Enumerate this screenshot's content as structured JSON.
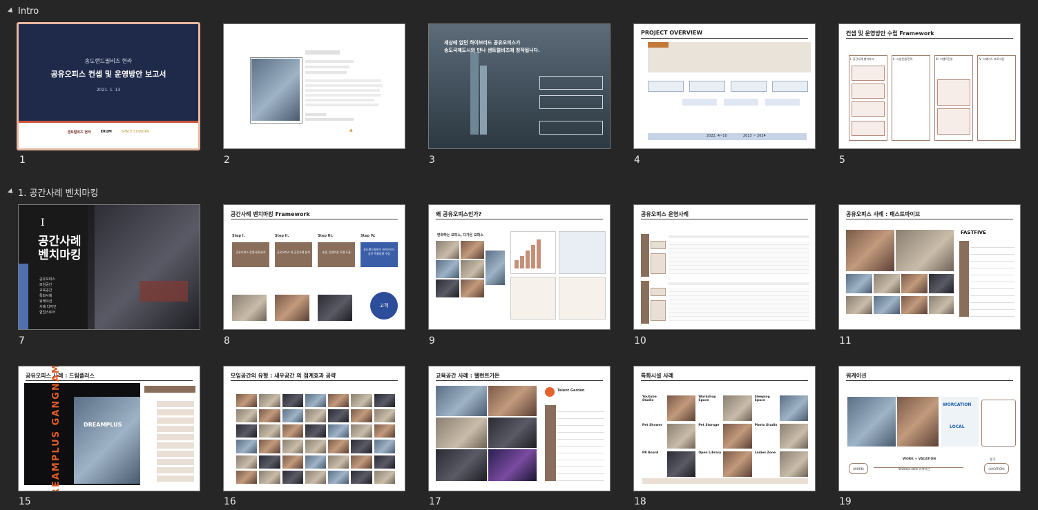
{
  "sections": [
    {
      "title": "Intro"
    },
    {
      "title": "1. 공간사례 벤치마킹"
    }
  ],
  "slides": [
    {
      "num": "1",
      "section": 0,
      "title": "송도랜드필비즈 현라",
      "subtitle": "공유오피스 컨셉 및 운영방안 보고서",
      "date": "2021. 1. 13",
      "logos": [
        "센트럴비즈 현라",
        "ERUM",
        "SPACE COWORK"
      ]
    },
    {
      "num": "2",
      "section": 0
    },
    {
      "num": "3",
      "section": 0,
      "headline1": "세상에 없던 하이브리드 공유오피스가",
      "headline2": "송도국제도시와 만나 센트럴비즈에 창작됩니다."
    },
    {
      "num": "4",
      "section": 0,
      "title": "PROJECT OVERVIEW",
      "phases": [
        "2022. 4~10",
        "2023 ~ 2024"
      ]
    },
    {
      "num": "5",
      "section": 0,
      "title": "컨셉 및 운영방안 수립 Framework",
      "cols": [
        "I. 공간사례 벤치마크",
        "II. 사업컨셉/전략",
        "III. 이벤트운영",
        "IV. 스페이스 프로그램"
      ]
    },
    {
      "num": "7",
      "section": 1,
      "roman": "I",
      "title1": "공간사례",
      "title2": "벤치마킹",
      "items": [
        "공유오피스",
        "모임공간",
        "교육공간",
        "특화사례",
        "워케이션",
        "사례 디자인",
        "협업스토어"
      ]
    },
    {
      "num": "8",
      "section": 1,
      "title": "공간사례 벤치마킹 Framework",
      "steps": [
        "Step I.",
        "Step II.",
        "Step III.",
        "Step IV."
      ],
      "step_boxes": [
        "공유오피스 운영사례 분석",
        "공유오피스 외 공간사례 분석",
        "사용, 운영혁신 모델 도출",
        "송도랜드필비즈 하이브리드 공간 적용방향 수립"
      ],
      "circle": "고객"
    },
    {
      "num": "9",
      "section": 1,
      "title": "왜 공유오피스인가?",
      "sub": "변화하는 오피스, 다가온 오피스"
    },
    {
      "num": "10",
      "section": 1,
      "title": "공유오피스 운영사례"
    },
    {
      "num": "11",
      "section": 1,
      "title": "공유오피스 사례 : 패스트파이브",
      "brand": "FASTFIVE"
    },
    {
      "num": "15",
      "section": 1,
      "title": "공유오피스 사례 : 드림플러스",
      "vertical": "DREAMPLUS GANGNAM",
      "sign": "DREAMPLUS"
    },
    {
      "num": "16",
      "section": 1,
      "title": "모임공간의 유형 : 새우공간 의 점계효과 공략"
    },
    {
      "num": "17",
      "section": 1,
      "title": "교육공간 사례 : 탤런트가든",
      "brand": "Talent Garden"
    },
    {
      "num": "18",
      "section": 1,
      "title": "특화시설 사례",
      "cells": [
        "Youtube Studio",
        "Workshop Space",
        "Sleeping Space",
        "Pet Shower",
        "Pet Storage",
        "Photo Studio",
        "PR Board",
        "Open Library",
        "Ladies Zone"
      ]
    },
    {
      "num": "19",
      "section": 1,
      "title": "워케이션",
      "w1": "WORCATION",
      "w2": "LOCAL",
      "flow": [
        "WORK + VACATION",
        "WORKATION 워케이션",
        "휴가"
      ],
      "flow_sub": [
        "(WORK)",
        "(VACATION)"
      ]
    }
  ]
}
